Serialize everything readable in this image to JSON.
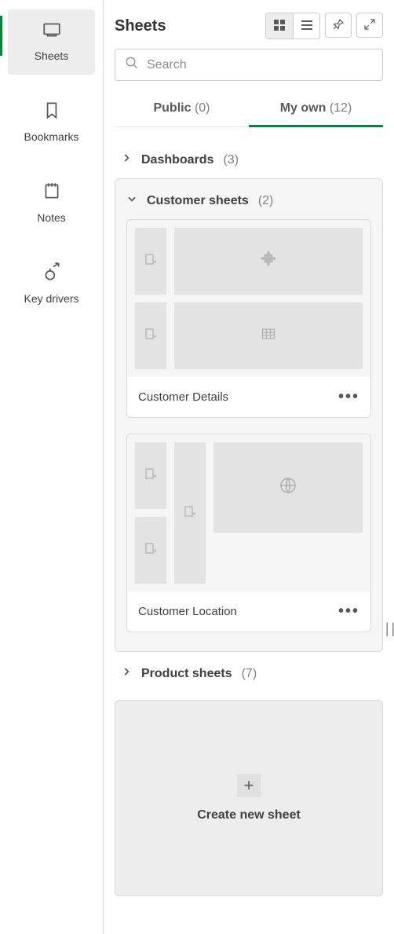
{
  "sidebar": {
    "items": [
      {
        "label": "Sheets",
        "icon": "sheets-icon",
        "active": true
      },
      {
        "label": "Bookmarks",
        "icon": "bookmark-icon",
        "active": false
      },
      {
        "label": "Notes",
        "icon": "notes-icon",
        "active": false
      },
      {
        "label": "Key drivers",
        "icon": "key-drivers-icon",
        "active": false
      }
    ]
  },
  "header": {
    "title": "Sheets"
  },
  "search": {
    "placeholder": "Search"
  },
  "tabs": {
    "public": {
      "label": "Public",
      "count": "(0)"
    },
    "my_own": {
      "label": "My own",
      "count": "(12)"
    }
  },
  "groups": {
    "dashboards": {
      "label": "Dashboards",
      "count": "(3)",
      "expanded": false
    },
    "customers": {
      "label": "Customer sheets",
      "count": "(2)",
      "expanded": true,
      "sheets": [
        {
          "title": "Customer Details"
        },
        {
          "title": "Customer Location"
        }
      ]
    },
    "products": {
      "label": "Product sheets",
      "count": "(7)",
      "expanded": false
    }
  },
  "create": {
    "label": "Create new sheet"
  }
}
